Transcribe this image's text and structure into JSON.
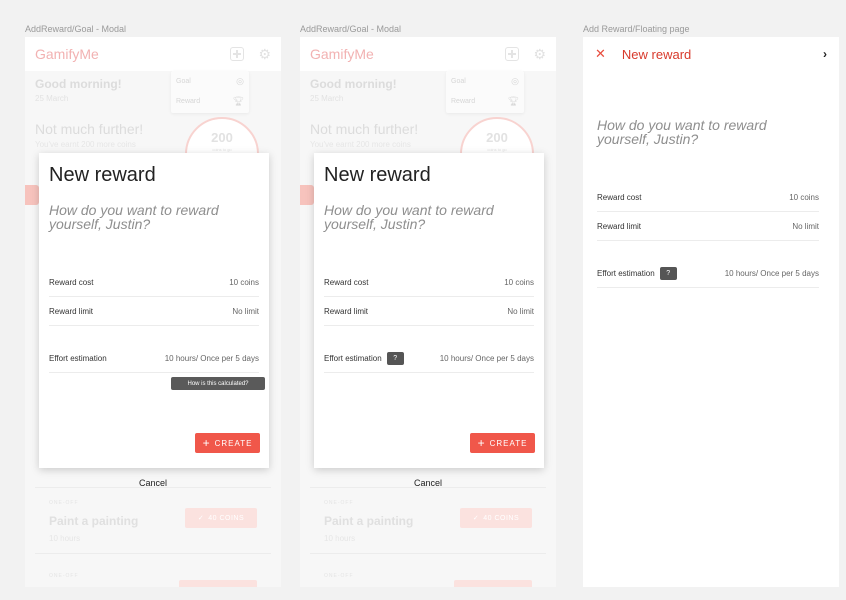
{
  "frames": [
    {
      "label": "AddReward/Goal - Modal"
    },
    {
      "label": "AddReward/Goal - Modal"
    },
    {
      "label": "Add Reward/Floating page"
    }
  ],
  "app": {
    "brand": "GamifyMe",
    "greeting": "Good morning!",
    "date": "25 March",
    "headline": "Not much further!",
    "earnt": "You've earnt 200 more coins",
    "coins_value": "200",
    "coins_sub": "coins to go",
    "menu_goal": "Goal",
    "menu_reward": "Reward",
    "item1_tag": "ONE-OFF",
    "item1_title": "Paint a painting",
    "item1_hours": "10 hours",
    "item1_coins": "40 COINS",
    "item2_tag": "ONE-OFF"
  },
  "modal": {
    "title": "New reward",
    "question": "How do you want to reward yourself, Justin?",
    "reward_cost_label": "Reward cost",
    "reward_cost_value": "10 coins",
    "reward_limit_label": "Reward limit",
    "reward_limit_value": "No limit",
    "effort_label": "Effort estimation",
    "effort_value": "10 hours/ Once per 5 days",
    "help_badge": "?",
    "tooltip": "How is this calculated?",
    "create_label": "CREATE",
    "cancel_label": "Cancel"
  },
  "floating": {
    "title": "New reward",
    "question": "How do you want to reward yourself, Justin?",
    "reward_cost_label": "Reward cost",
    "reward_cost_value": "10 coins",
    "reward_limit_label": "Reward limit",
    "reward_limit_value": "No limit",
    "effort_label": "Effort estimation",
    "effort_value": "10 hours/ Once per 5 days",
    "help_badge": "?"
  },
  "colors": {
    "accent": "#f0574a",
    "title_red": "#d83a2c",
    "canvas": "#f2f2f2"
  }
}
